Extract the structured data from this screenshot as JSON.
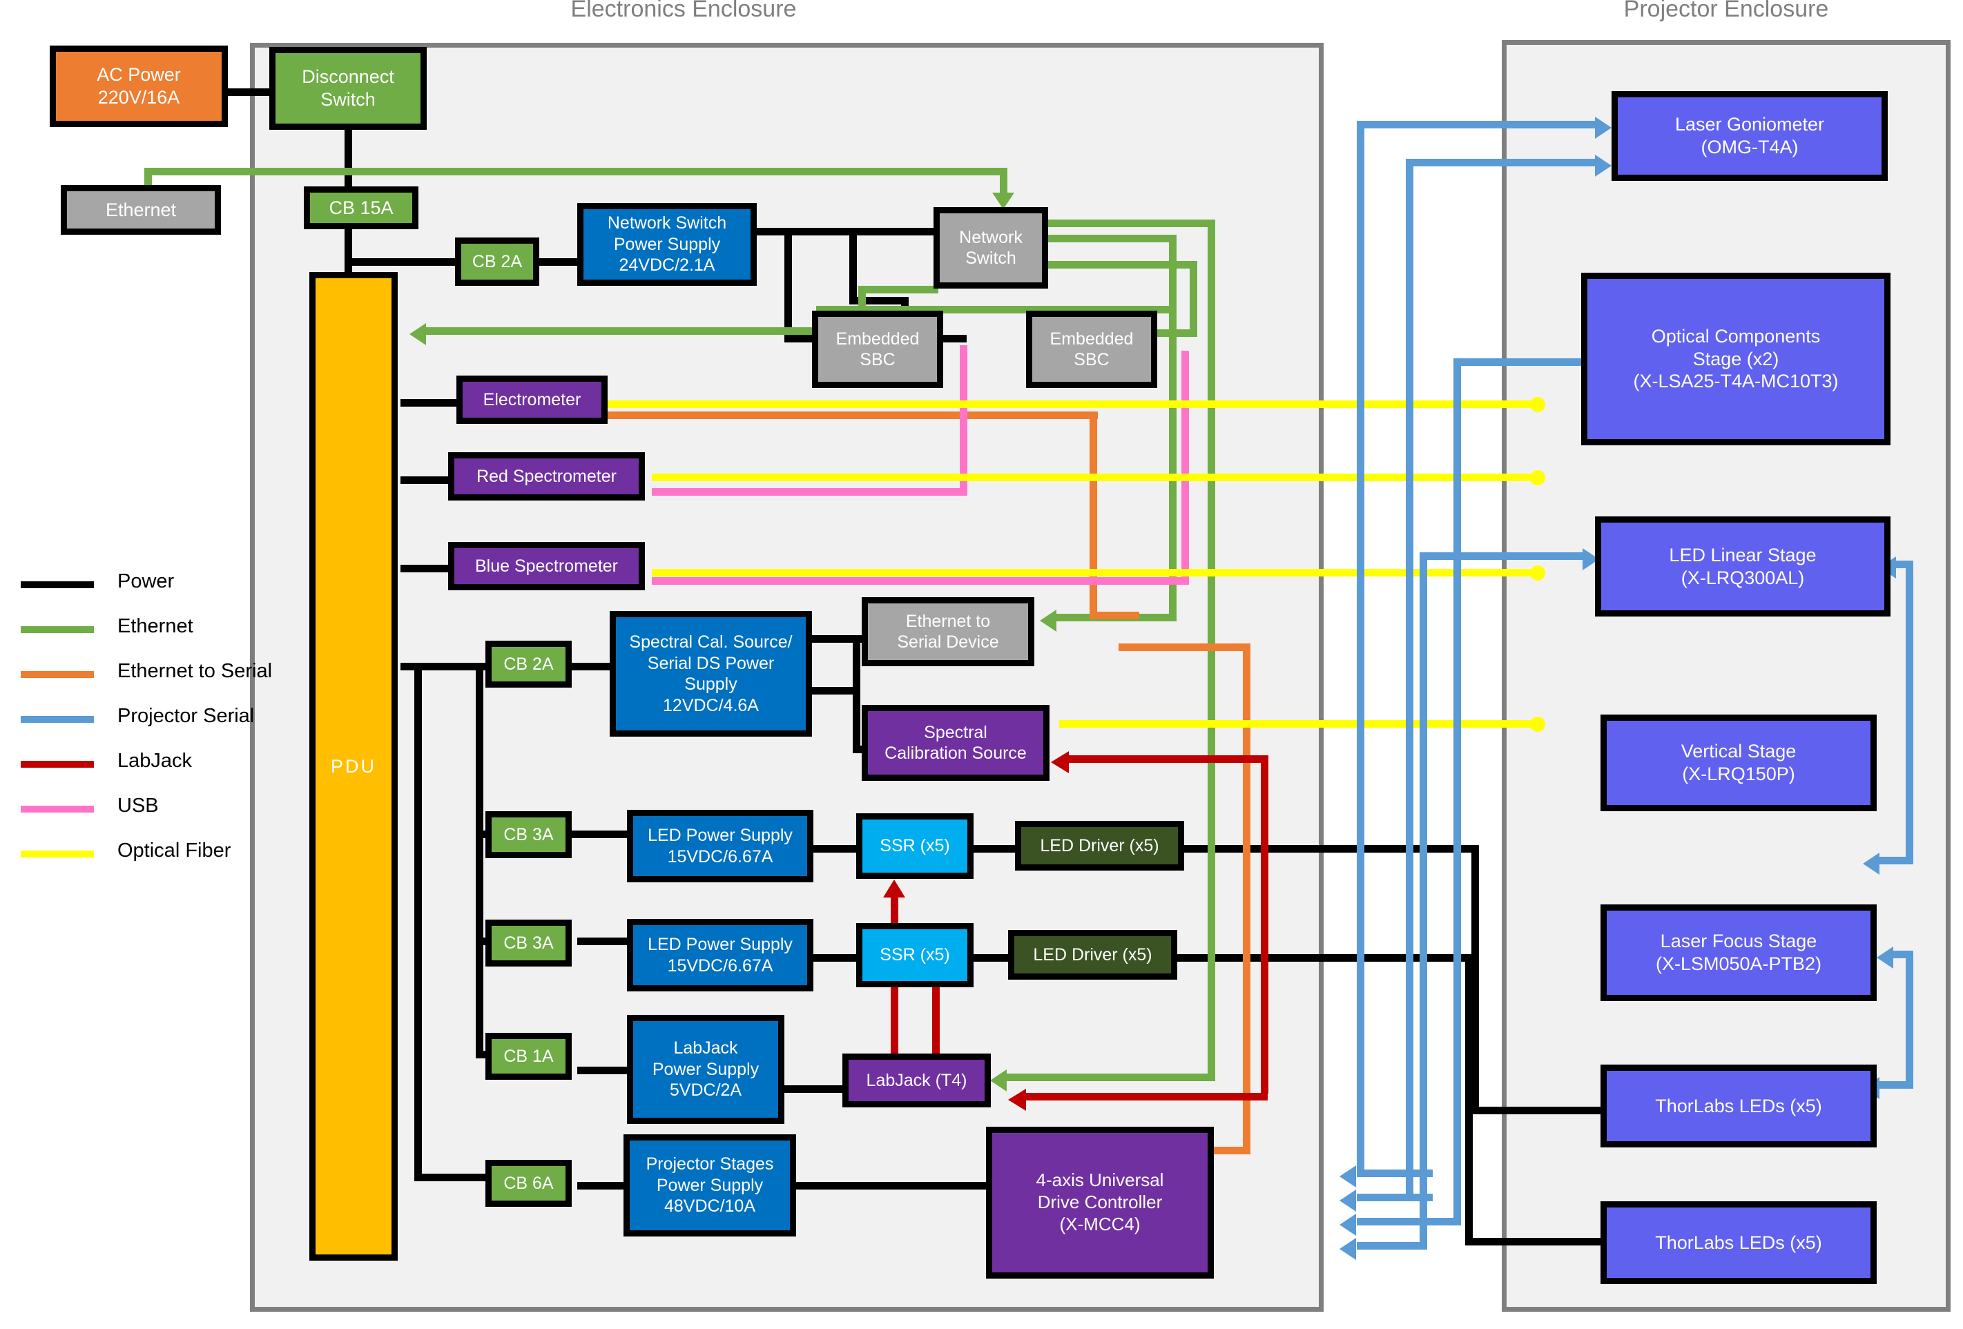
{
  "enclosures": [
    {
      "id": "electronics",
      "title": "Electronics Enclosure"
    },
    {
      "id": "projector",
      "title": "Projector Enclosure"
    }
  ],
  "legend": {
    "items": [
      {
        "label": "Power",
        "color": "#000000"
      },
      {
        "label": "Ethernet",
        "color": "#70AD47"
      },
      {
        "label": "Ethernet to Serial",
        "color": "#ED7D31"
      },
      {
        "label": "Projector Serial",
        "color": "#5B9BD5"
      },
      {
        "label": "LabJack",
        "color": "#C00000"
      },
      {
        "label": "USB",
        "color": "#FF74C8"
      },
      {
        "label": "Optical Fiber",
        "color": "#FFFF00"
      }
    ]
  },
  "external": {
    "ac_power": {
      "line1": "AC Power",
      "line2": "220V/16A",
      "color": "#ED7D31"
    },
    "ethernet_port": {
      "line1": "Ethernet",
      "color": "#A6A6A6"
    }
  },
  "electronics": {
    "disconnect_switch": {
      "line1": "Disconnect",
      "line2": "Switch"
    },
    "cb_15a": {
      "line1": "CB 15A"
    },
    "pdu": {
      "line1": "PDU"
    },
    "cb_2a_net": {
      "line1": "CB 2A"
    },
    "net_switch_psu": {
      "line1": "Network Switch",
      "line2": "Power Supply",
      "line3": "24VDC/2.1A"
    },
    "network_switch": {
      "line1": "Network",
      "line2": "Switch"
    },
    "sbc_1": {
      "line1": "Embedded",
      "line2": "SBC"
    },
    "sbc_2": {
      "line1": "Embedded",
      "line2": "SBC"
    },
    "electrometer": {
      "line1": "Electrometer"
    },
    "red_spec": {
      "line1": "Red Spectrometer"
    },
    "blue_spec": {
      "line1": "Blue Spectrometer"
    },
    "cb_2a_spec": {
      "line1": "CB 2A"
    },
    "spec_psu": {
      "line1": "Spectral Cal. Source/",
      "line2": "Serial DS Power",
      "line3": "Supply",
      "line4": "12VDC/4.6A"
    },
    "eth_to_serial": {
      "line1": "Ethernet to",
      "line2": "Serial Device"
    },
    "spec_cal_source": {
      "line1": "Spectral",
      "line2": "Calibration Source"
    },
    "cb_3a_a": {
      "line1": "CB 3A"
    },
    "led_psu_a": {
      "line1": "LED Power Supply",
      "line2": "15VDC/6.67A"
    },
    "ssr_a": {
      "line1": "SSR (x5)"
    },
    "led_driver_a": {
      "line1": "LED Driver (x5)"
    },
    "cb_3a_b": {
      "line1": "CB 3A"
    },
    "led_psu_b": {
      "line1": "LED Power Supply",
      "line2": "15VDC/6.67A"
    },
    "ssr_b": {
      "line1": "SSR (x5)"
    },
    "led_driver_b": {
      "line1": "LED Driver (x5)"
    },
    "cb_1a": {
      "line1": "CB 1A"
    },
    "labjack_psu": {
      "line1": "LabJack",
      "line2": "Power Supply",
      "line3": "5VDC/2A"
    },
    "labjack": {
      "line1": "LabJack (T4)"
    },
    "cb_6a": {
      "line1": "CB 6A"
    },
    "proj_stage_psu": {
      "line1": "Projector Stages",
      "line2": "Power Supply",
      "line3": "48VDC/10A"
    },
    "drive_controller": {
      "line1": "4-axis Universal",
      "line2": "Drive Controller",
      "line3": "(X-MCC4)"
    }
  },
  "projector": {
    "laser_goniometer": {
      "line1": "Laser Goniometer",
      "line2": "(OMG-T4A)"
    },
    "optical_stage": {
      "line1": "Optical Components",
      "line2": "Stage (x2)",
      "line3": "(X-LSA25-T4A-MC10T3)"
    },
    "led_linear_stage": {
      "line1": "LED Linear Stage",
      "line2": "(X-LRQ300AL)"
    },
    "vertical_stage": {
      "line1": "Vertical Stage",
      "line2": "(X-LRQ150P)"
    },
    "laser_focus_stage": {
      "line1": "Laser Focus Stage",
      "line2": "(X-LSM050A-PTB2)"
    },
    "thorlabs_leds_1": {
      "line1": "ThorLabs LEDs (x5)"
    },
    "thorlabs_leds_2": {
      "line1": "ThorLabs LEDs (x5)"
    }
  },
  "colors": {
    "power": "#000000",
    "ethernet": "#70AD47",
    "eth_to_serial": "#ED7D31",
    "projector_serial": "#5B9BD5",
    "labjack": "#C00000",
    "usb": "#FF74C8",
    "optical_fiber": "#FFFF00",
    "enclosure_border": "#7f7f7f",
    "enclosure_fill": "#f1f1f1"
  }
}
